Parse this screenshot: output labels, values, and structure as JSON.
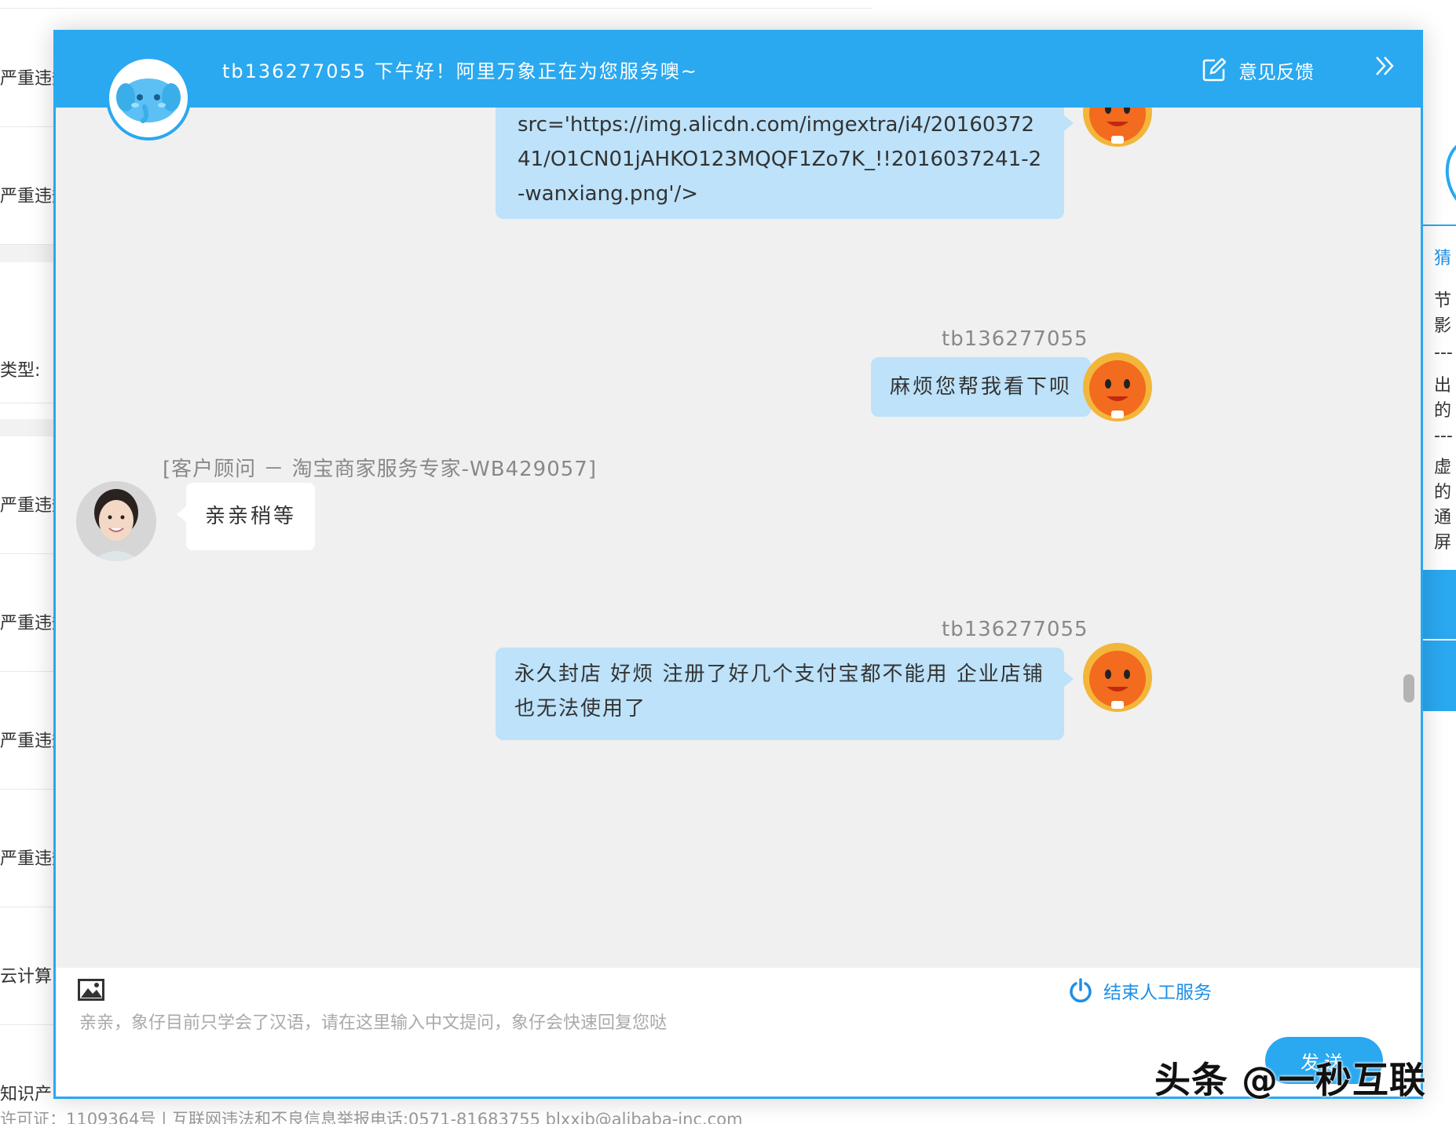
{
  "background": {
    "left_items": [
      "严重违规",
      "严重违规",
      "类型:",
      "严重违规",
      "严重违规",
      "严重违规",
      "严重违规",
      "云计算",
      "知识产"
    ],
    "footer_text": "许可证：1109364号  |  互联网违法和不良信息举报电话:0571-81683755 blxxjb@alibaba-inc.com",
    "right_panel_lines": [
      "猜",
      "节",
      "影",
      "---",
      "出",
      "的",
      "---",
      "虚",
      "的",
      "通",
      "屏"
    ]
  },
  "header": {
    "title": "tb136277055 下午好！阿里万象正在为您服务噢~",
    "feedback_label": "意见反馈"
  },
  "messages": [
    {
      "role": "user",
      "sender": "",
      "text": "src='https://img.alicdn.com/imgextra/i4/2016037241/O1CN01jAHKO123MQQF1Zo7K_!!2016037241-2-wanxiang.png'/>"
    },
    {
      "role": "user",
      "sender": "tb136277055",
      "text": "麻烦您帮我看下呗"
    },
    {
      "role": "agent",
      "sender": "[客户顾问 － 淘宝商家服务专家-WB429057]",
      "text": "亲亲稍等"
    },
    {
      "role": "user",
      "sender": "tb136277055",
      "text": "永久封店 好烦 注册了好几个支付宝都不能用 企业店铺也无法使用了"
    }
  ],
  "input": {
    "placeholder": "亲亲，象仔目前只学会了汉语，请在这里输入中文提问，象仔会快速回复您哒",
    "value": "",
    "end_service_label": "结束人工服务",
    "send_label": "发送"
  },
  "watermark": "头条 @一秒互联",
  "colors": {
    "primary": "#2aa8f0",
    "user_bubble": "#bde2fa",
    "chat_bg": "#f0f0f0",
    "link_blue": "#1e8fe6"
  }
}
